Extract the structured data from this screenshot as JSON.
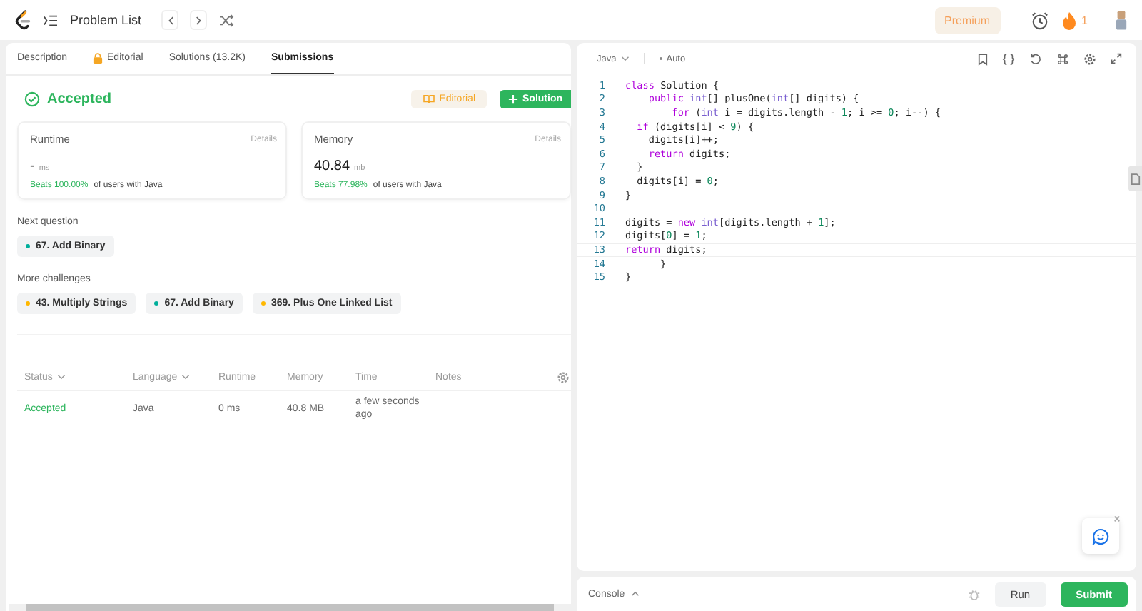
{
  "topbar": {
    "title": "Problem List",
    "premium": "Premium",
    "streak": "1"
  },
  "tabs": [
    {
      "label": "Description",
      "selected": false,
      "locked": false
    },
    {
      "label": "Editorial",
      "selected": false,
      "locked": true
    },
    {
      "label": "Solutions (13.2K)",
      "selected": false,
      "locked": false
    },
    {
      "label": "Submissions",
      "selected": true,
      "locked": false
    }
  ],
  "result": {
    "status": "Accepted",
    "editorial_button": "Editorial",
    "solution_button": "Solution"
  },
  "stats": [
    {
      "label": "Runtime",
      "details": "Details",
      "value": "-",
      "unit": "ms",
      "beats": "Beats 100.00%",
      "beats_suffix": "of users with Java"
    },
    {
      "label": "Memory",
      "details": "Details",
      "value": "40.84",
      "unit": "mb",
      "beats": "Beats 77.98%",
      "beats_suffix": "of users with Java"
    }
  ],
  "next_question": {
    "heading": "Next question",
    "items": [
      {
        "label": "67. Add Binary",
        "color": "#00af9b"
      }
    ]
  },
  "more_challenges": {
    "heading": "More challenges",
    "items": [
      {
        "label": "43. Multiply Strings",
        "color": "#ffb800"
      },
      {
        "label": "67. Add Binary",
        "color": "#00af9b"
      },
      {
        "label": "369. Plus One Linked List",
        "color": "#ffb800"
      }
    ]
  },
  "table": {
    "columns": [
      {
        "label": "Status",
        "sortable": true
      },
      {
        "label": "Language",
        "sortable": true
      },
      {
        "label": "Runtime",
        "sortable": false
      },
      {
        "label": "Memory",
        "sortable": false
      },
      {
        "label": "Time",
        "sortable": false
      },
      {
        "label": "Notes",
        "sortable": false
      }
    ],
    "rows": [
      {
        "status": "Accepted",
        "language": "Java",
        "runtime": "0 ms",
        "memory": "40.8 MB",
        "time": "a few seconds ago"
      }
    ]
  },
  "editor": {
    "language": "Java",
    "mode": "Auto",
    "lines": [
      {
        "number": "1",
        "tokens": [
          {
            "text": "class ",
            "kind": "kw"
          },
          {
            "text": "Solution {",
            "kind": "plain"
          }
        ]
      },
      {
        "number": "2",
        "tokens": [
          {
            "text": "    public ",
            "kind": "kw"
          },
          {
            "text": "int",
            "kind": "type"
          },
          {
            "text": "[] plusOne(",
            "kind": "plain"
          },
          {
            "text": "int",
            "kind": "type"
          },
          {
            "text": "[] digits) {",
            "kind": "plain"
          }
        ]
      },
      {
        "number": "3",
        "tokens": [
          {
            "text": "        for ",
            "kind": "kw"
          },
          {
            "text": "(",
            "kind": "plain"
          },
          {
            "text": "int",
            "kind": "type"
          },
          {
            "text": " i = digits.length - ",
            "kind": "plain"
          },
          {
            "text": "1",
            "kind": "num"
          },
          {
            "text": "; i >= ",
            "kind": "plain"
          },
          {
            "text": "0",
            "kind": "num"
          },
          {
            "text": "; i--) {",
            "kind": "plain"
          }
        ]
      },
      {
        "number": "4",
        "tokens": [
          {
            "text": "  if ",
            "kind": "kw"
          },
          {
            "text": "(digits[i] < ",
            "kind": "plain"
          },
          {
            "text": "9",
            "kind": "num"
          },
          {
            "text": ") {",
            "kind": "plain"
          }
        ]
      },
      {
        "number": "5",
        "tokens": [
          {
            "text": "    digits[i]++;",
            "kind": "plain"
          }
        ]
      },
      {
        "number": "6",
        "tokens": [
          {
            "text": "    return ",
            "kind": "kw"
          },
          {
            "text": "digits;",
            "kind": "plain"
          }
        ]
      },
      {
        "number": "7",
        "tokens": [
          {
            "text": "  }",
            "kind": "plain"
          }
        ]
      },
      {
        "number": "8",
        "tokens": [
          {
            "text": "  digits[i] = ",
            "kind": "plain"
          },
          {
            "text": "0",
            "kind": "num"
          },
          {
            "text": ";",
            "kind": "plain"
          }
        ]
      },
      {
        "number": "9",
        "tokens": [
          {
            "text": "}",
            "kind": "plain"
          }
        ]
      },
      {
        "number": "10"
      },
      {
        "number": "11",
        "tokens": [
          {
            "text": "digits = ",
            "kind": "plain"
          },
          {
            "text": "new ",
            "kind": "kw"
          },
          {
            "text": "int",
            "kind": "type"
          },
          {
            "text": "[digits.length + ",
            "kind": "plain"
          },
          {
            "text": "1",
            "kind": "num"
          },
          {
            "text": "];",
            "kind": "plain"
          }
        ]
      },
      {
        "number": "12",
        "tokens": [
          {
            "text": "digits[",
            "kind": "plain"
          },
          {
            "text": "0",
            "kind": "num"
          },
          {
            "text": "] = ",
            "kind": "plain"
          },
          {
            "text": "1",
            "kind": "num"
          },
          {
            "text": ";",
            "kind": "plain"
          }
        ]
      },
      {
        "number": "13",
        "tokens": [
          {
            "text": "return ",
            "kind": "kw"
          },
          {
            "text": "digits;",
            "kind": "plain"
          }
        ]
      },
      {
        "number": "14",
        "tokens": [
          {
            "text": "      }",
            "kind": "plain"
          }
        ]
      },
      {
        "number": "15",
        "tokens": [
          {
            "text": "}",
            "kind": "plain"
          }
        ]
      }
    ]
  },
  "console": {
    "label": "Console",
    "run_button": "Run",
    "submit_button": "Submit"
  }
}
